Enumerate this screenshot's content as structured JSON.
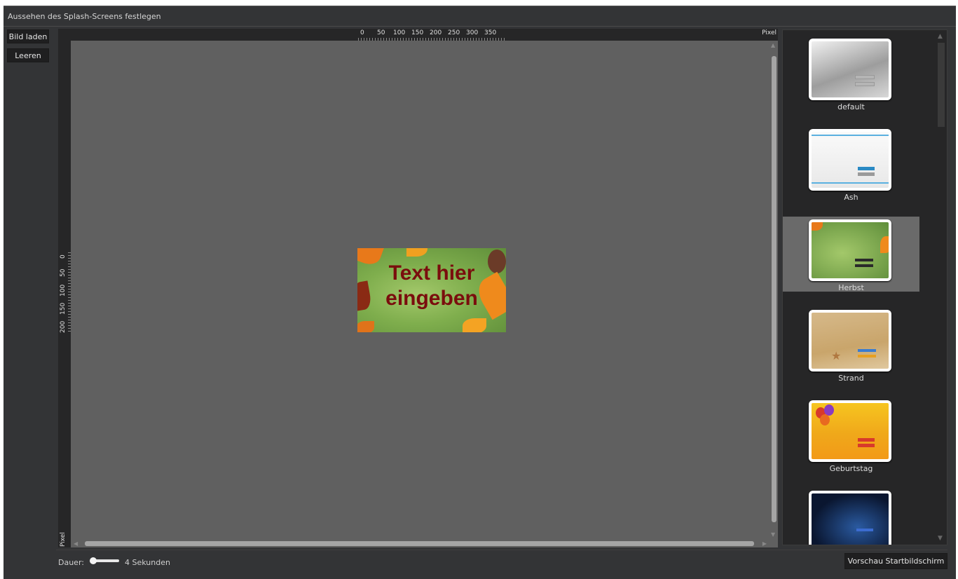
{
  "window": {
    "title": "Aussehen des Splash-Screens festlegen"
  },
  "toolbar": {
    "load_label": "Bild laden",
    "clear_label": "Leeren"
  },
  "ruler": {
    "top_labels": [
      "0",
      "50",
      "100",
      "150",
      "200",
      "250",
      "300",
      "350"
    ],
    "left_labels": [
      "0",
      "50",
      "100",
      "150",
      "200"
    ],
    "unit": "Pixel"
  },
  "preview": {
    "text": "Text hier eingeben",
    "text_color": "#7a0d0d"
  },
  "gallery": {
    "selected": "Herbst",
    "items": [
      {
        "label": "default"
      },
      {
        "label": "Ash"
      },
      {
        "label": "Herbst"
      },
      {
        "label": "Strand"
      },
      {
        "label": "Geburtstag"
      },
      {
        "label": ""
      }
    ]
  },
  "footer": {
    "duration_label": "Dauer:",
    "duration_value": "4 Sekunden",
    "preview_button": "Vorschau Startbildschirm"
  },
  "colors": {
    "background": "#333436",
    "canvas": "#606060",
    "selected": "#6a6a6a"
  }
}
